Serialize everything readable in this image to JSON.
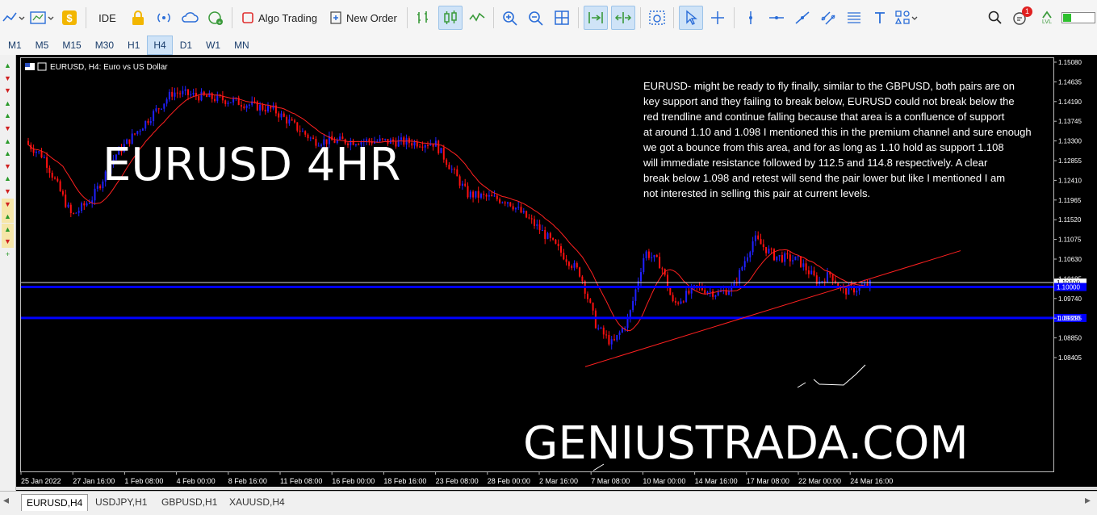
{
  "toolbar": {
    "ide_label": "IDE",
    "algo_label": "Algo Trading",
    "new_order_label": "New Order",
    "notification_count": "1",
    "lvl_label": "LVL"
  },
  "timeframes": [
    "M1",
    "M5",
    "M15",
    "M30",
    "H1",
    "H4",
    "D1",
    "W1",
    "MN"
  ],
  "active_timeframe": "H4",
  "chart": {
    "title": "EURUSD, H4:  Euro vs US Dollar",
    "watermark": "EURUSD 4HR",
    "brand_text": "GENIUSTRADA.COM",
    "analysis": "EURUSD- might be ready to fly finally, similar to the GBPUSD, both pairs are on key support and they failing to break below, EURUSD could not break below the red trendline and continue falling because that area is a confluence of support at around 1.10 and 1.098 I mentioned this in the premium channel and sure enough we got a bounce from this area, and for as long as 1.10 hold as support 1.108 will immediate resistance followed by 112.5 and 114.8 respectively. A clear break below 1.098 and retest will send the pair lower but like I mentioned I am not interested in selling this pair at current levels.",
    "price_labels": [
      "1.15080",
      "1.14635",
      "1.14190",
      "1.13745",
      "1.13300",
      "1.12855",
      "1.12410",
      "1.11965",
      "1.11520",
      "1.11075",
      "1.10630",
      "1.10185",
      "1.09740",
      "1.09295",
      "1.08850",
      "1.08405"
    ],
    "current_price": "1.10100",
    "level_upper": "1.10000",
    "level_lower": "1.09300",
    "time_labels": [
      "25 Jan 2022",
      "27 Jan 16:00",
      "1 Feb 08:00",
      "4 Feb 00:00",
      "8 Feb 16:00",
      "11 Feb 08:00",
      "16 Feb 00:00",
      "18 Feb 16:00",
      "23 Feb 08:00",
      "28 Feb 00:00",
      "2 Mar 16:00",
      "7 Mar 08:00",
      "10 Mar 00:00",
      "14 Mar 16:00",
      "17 Mar 08:00",
      "22 Mar 00:00",
      "24 Mar 16:00"
    ]
  },
  "tabs": [
    "EURUSD,H4",
    "USDJPY,H1",
    "GBPUSD,H1",
    "XAUUSD,H4"
  ],
  "active_tab": "EURUSD,H4",
  "colors": {
    "bull": "#2020ff",
    "bear": "#ff1010",
    "ma": "#ff2020",
    "level": "#0000ff",
    "background": "#000000",
    "grid_text": "#ffffff"
  }
}
